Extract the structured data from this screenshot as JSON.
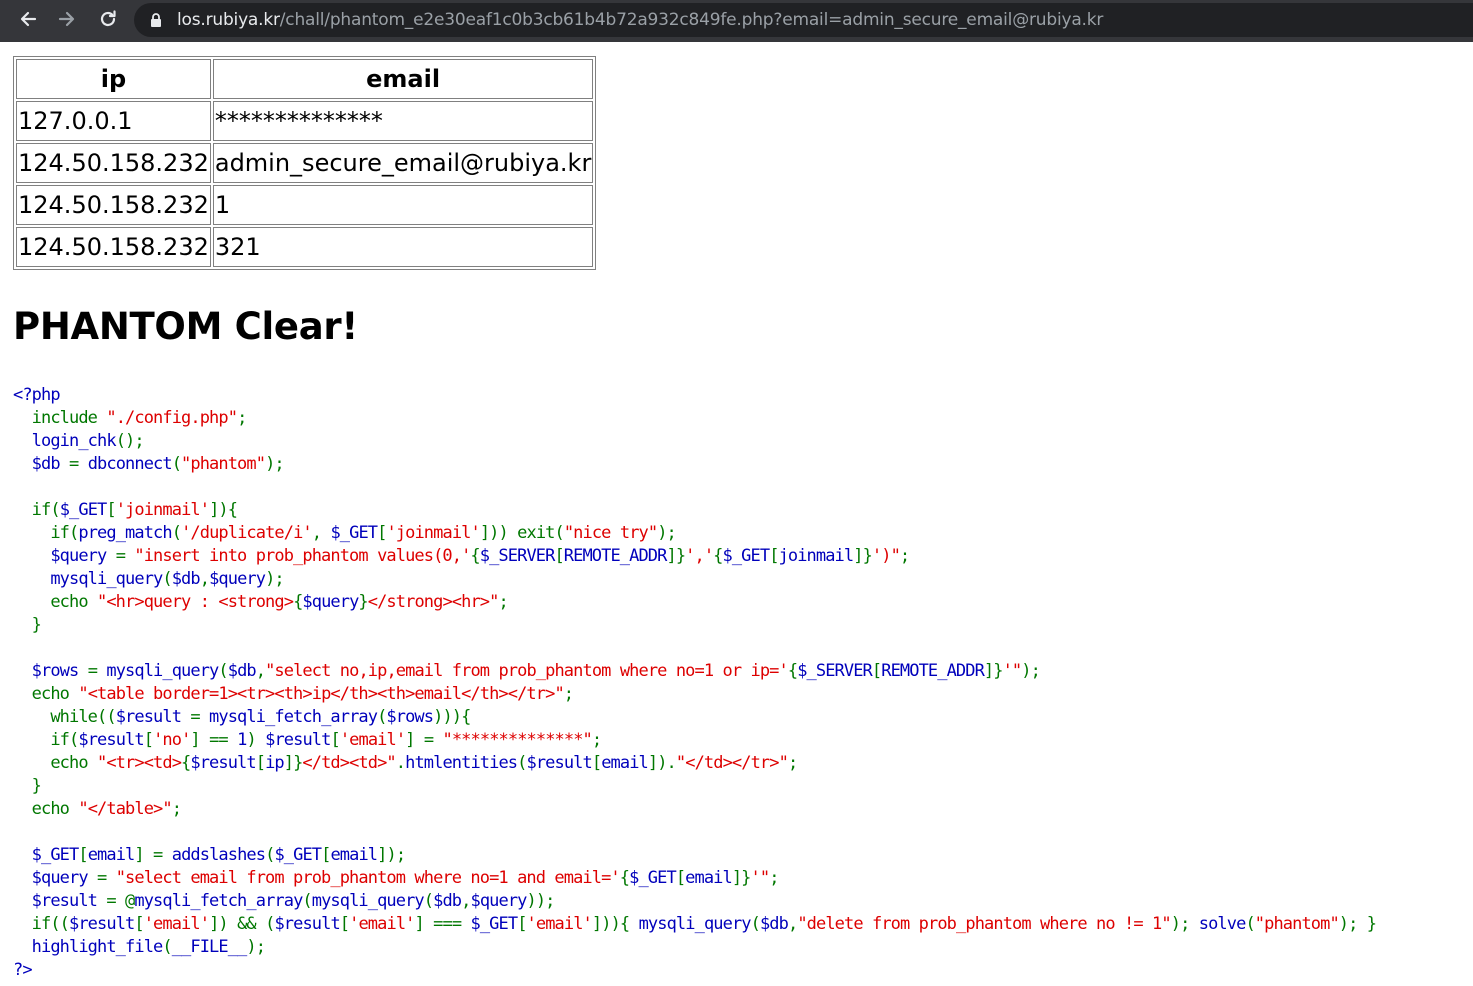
{
  "browser": {
    "url_host": "los.rubiya.kr",
    "url_path": "/chall/phantom_e2e30eaf1c0b3cb61b4b72a932c849fe.php?email=admin_secure_email@rubiya.kr",
    "icons": {
      "back": "arrow-left-icon",
      "forward": "arrow-right-icon",
      "reload": "reload-icon",
      "lock": "lock-icon"
    }
  },
  "result_table": {
    "headers": [
      "ip",
      "email"
    ],
    "rows": [
      [
        "127.0.0.1",
        "**************"
      ],
      [
        "124.50.158.232",
        "admin_secure_email@rubiya.kr"
      ],
      [
        "124.50.158.232",
        "1"
      ],
      [
        "124.50.158.232",
        "321"
      ]
    ]
  },
  "message": "PHANTOM Clear!",
  "source_code": [
    [
      [
        "df",
        "<?php"
      ]
    ],
    [
      [
        "kw",
        "  include "
      ],
      [
        "st",
        "\"./config.php\""
      ],
      [
        "kw",
        ";"
      ]
    ],
    [
      [
        "df",
        "  login_chk"
      ],
      [
        "kw",
        "();"
      ]
    ],
    [
      [
        "df",
        "  $db "
      ],
      [
        "kw",
        "= "
      ],
      [
        "df",
        "dbconnect"
      ],
      [
        "kw",
        "("
      ],
      [
        "st",
        "\"phantom\""
      ],
      [
        "kw",
        ");"
      ]
    ],
    [],
    [
      [
        "kw",
        "  if("
      ],
      [
        "df",
        "$_GET"
      ],
      [
        "kw",
        "["
      ],
      [
        "st",
        "'joinmail'"
      ],
      [
        "kw",
        "]){"
      ]
    ],
    [
      [
        "kw",
        "    if("
      ],
      [
        "df",
        "preg_match"
      ],
      [
        "kw",
        "("
      ],
      [
        "st",
        "'/duplicate/i'"
      ],
      [
        "kw",
        ", "
      ],
      [
        "df",
        "$_GET"
      ],
      [
        "kw",
        "["
      ],
      [
        "st",
        "'joinmail'"
      ],
      [
        "kw",
        "])) exit("
      ],
      [
        "st",
        "\"nice try\""
      ],
      [
        "kw",
        ");"
      ]
    ],
    [
      [
        "df",
        "    $query "
      ],
      [
        "kw",
        "= "
      ],
      [
        "st",
        "\"insert into prob_phantom values(0,'"
      ],
      [
        "kw",
        "{"
      ],
      [
        "df",
        "$_SERVER"
      ],
      [
        "kw",
        "["
      ],
      [
        "df",
        "REMOTE_ADDR"
      ],
      [
        "kw",
        "]}"
      ],
      [
        "st",
        "','"
      ],
      [
        "kw",
        "{"
      ],
      [
        "df",
        "$_GET"
      ],
      [
        "kw",
        "["
      ],
      [
        "df",
        "joinmail"
      ],
      [
        "kw",
        "]}"
      ],
      [
        "st",
        "')\""
      ],
      [
        "kw",
        ";"
      ]
    ],
    [
      [
        "df",
        "    mysqli_query"
      ],
      [
        "kw",
        "("
      ],
      [
        "df",
        "$db"
      ],
      [
        "kw",
        ","
      ],
      [
        "df",
        "$query"
      ],
      [
        "kw",
        ");"
      ]
    ],
    [
      [
        "kw",
        "    echo "
      ],
      [
        "st",
        "\"<hr>query : <strong>"
      ],
      [
        "kw",
        "{"
      ],
      [
        "df",
        "$query"
      ],
      [
        "kw",
        "}"
      ],
      [
        "st",
        "</strong><hr>\""
      ],
      [
        "kw",
        ";"
      ]
    ],
    [
      [
        "kw",
        "  }"
      ]
    ],
    [],
    [
      [
        "df",
        "  $rows "
      ],
      [
        "kw",
        "= "
      ],
      [
        "df",
        "mysqli_query"
      ],
      [
        "kw",
        "("
      ],
      [
        "df",
        "$db"
      ],
      [
        "kw",
        ","
      ],
      [
        "st",
        "\"select no,ip,email from prob_phantom where no=1 or ip='"
      ],
      [
        "kw",
        "{"
      ],
      [
        "df",
        "$_SERVER"
      ],
      [
        "kw",
        "["
      ],
      [
        "df",
        "REMOTE_ADDR"
      ],
      [
        "kw",
        "]}"
      ],
      [
        "st",
        "'\""
      ],
      [
        "kw",
        ");"
      ]
    ],
    [
      [
        "kw",
        "  echo "
      ],
      [
        "st",
        "\"<table border=1><tr><th>ip</th><th>email</th></tr>\""
      ],
      [
        "kw",
        ";"
      ]
    ],
    [
      [
        "kw",
        "    while(("
      ],
      [
        "df",
        "$result "
      ],
      [
        "kw",
        "= "
      ],
      [
        "df",
        "mysqli_fetch_array"
      ],
      [
        "kw",
        "("
      ],
      [
        "df",
        "$rows"
      ],
      [
        "kw",
        "))){"
      ]
    ],
    [
      [
        "kw",
        "    if("
      ],
      [
        "df",
        "$result"
      ],
      [
        "kw",
        "["
      ],
      [
        "st",
        "'no'"
      ],
      [
        "kw",
        "] == "
      ],
      [
        "df",
        "1"
      ],
      [
        "kw",
        ") "
      ],
      [
        "df",
        "$result"
      ],
      [
        "kw",
        "["
      ],
      [
        "st",
        "'email'"
      ],
      [
        "kw",
        "] = "
      ],
      [
        "st",
        "\"**************\""
      ],
      [
        "kw",
        ";"
      ]
    ],
    [
      [
        "kw",
        "    echo "
      ],
      [
        "st",
        "\"<tr><td>"
      ],
      [
        "kw",
        "{"
      ],
      [
        "df",
        "$result"
      ],
      [
        "kw",
        "["
      ],
      [
        "df",
        "ip"
      ],
      [
        "kw",
        "]}"
      ],
      [
        "st",
        "</td><td>\""
      ],
      [
        "kw",
        "."
      ],
      [
        "df",
        "htmlentities"
      ],
      [
        "kw",
        "("
      ],
      [
        "df",
        "$result"
      ],
      [
        "kw",
        "["
      ],
      [
        "df",
        "email"
      ],
      [
        "kw",
        "])."
      ],
      [
        "st",
        "\"</td></tr>\""
      ],
      [
        "kw",
        ";"
      ]
    ],
    [
      [
        "kw",
        "  }"
      ]
    ],
    [
      [
        "kw",
        "  echo "
      ],
      [
        "st",
        "\"</table>\""
      ],
      [
        "kw",
        ";"
      ]
    ],
    [],
    [
      [
        "df",
        "  $_GET"
      ],
      [
        "kw",
        "["
      ],
      [
        "df",
        "email"
      ],
      [
        "kw",
        "] = "
      ],
      [
        "df",
        "addslashes"
      ],
      [
        "kw",
        "("
      ],
      [
        "df",
        "$_GET"
      ],
      [
        "kw",
        "["
      ],
      [
        "df",
        "email"
      ],
      [
        "kw",
        "]);"
      ]
    ],
    [
      [
        "df",
        "  $query "
      ],
      [
        "kw",
        "= "
      ],
      [
        "st",
        "\"select email from prob_phantom where no=1 and email='"
      ],
      [
        "kw",
        "{"
      ],
      [
        "df",
        "$_GET"
      ],
      [
        "kw",
        "["
      ],
      [
        "df",
        "email"
      ],
      [
        "kw",
        "]}"
      ],
      [
        "st",
        "'\""
      ],
      [
        "kw",
        ";"
      ]
    ],
    [
      [
        "df",
        "  $result "
      ],
      [
        "kw",
        "= @"
      ],
      [
        "df",
        "mysqli_fetch_array"
      ],
      [
        "kw",
        "("
      ],
      [
        "df",
        "mysqli_query"
      ],
      [
        "kw",
        "("
      ],
      [
        "df",
        "$db"
      ],
      [
        "kw",
        ","
      ],
      [
        "df",
        "$query"
      ],
      [
        "kw",
        "));"
      ]
    ],
    [
      [
        "kw",
        "  if(("
      ],
      [
        "df",
        "$result"
      ],
      [
        "kw",
        "["
      ],
      [
        "st",
        "'email'"
      ],
      [
        "kw",
        "]) && ("
      ],
      [
        "df",
        "$result"
      ],
      [
        "kw",
        "["
      ],
      [
        "st",
        "'email'"
      ],
      [
        "kw",
        "] === "
      ],
      [
        "df",
        "$_GET"
      ],
      [
        "kw",
        "["
      ],
      [
        "st",
        "'email'"
      ],
      [
        "kw",
        "])){ "
      ],
      [
        "df",
        "mysqli_query"
      ],
      [
        "kw",
        "("
      ],
      [
        "df",
        "$db"
      ],
      [
        "kw",
        ","
      ],
      [
        "st",
        "\"delete from prob_phantom where no != 1\""
      ],
      [
        "kw",
        "); "
      ],
      [
        "df",
        "solve"
      ],
      [
        "kw",
        "("
      ],
      [
        "st",
        "\"phantom\""
      ],
      [
        "kw",
        "); }"
      ]
    ],
    [
      [
        "df",
        "  highlight_file"
      ],
      [
        "kw",
        "("
      ],
      [
        "df",
        "__FILE__"
      ],
      [
        "kw",
        ");"
      ]
    ],
    [
      [
        "df",
        "?>"
      ]
    ]
  ]
}
